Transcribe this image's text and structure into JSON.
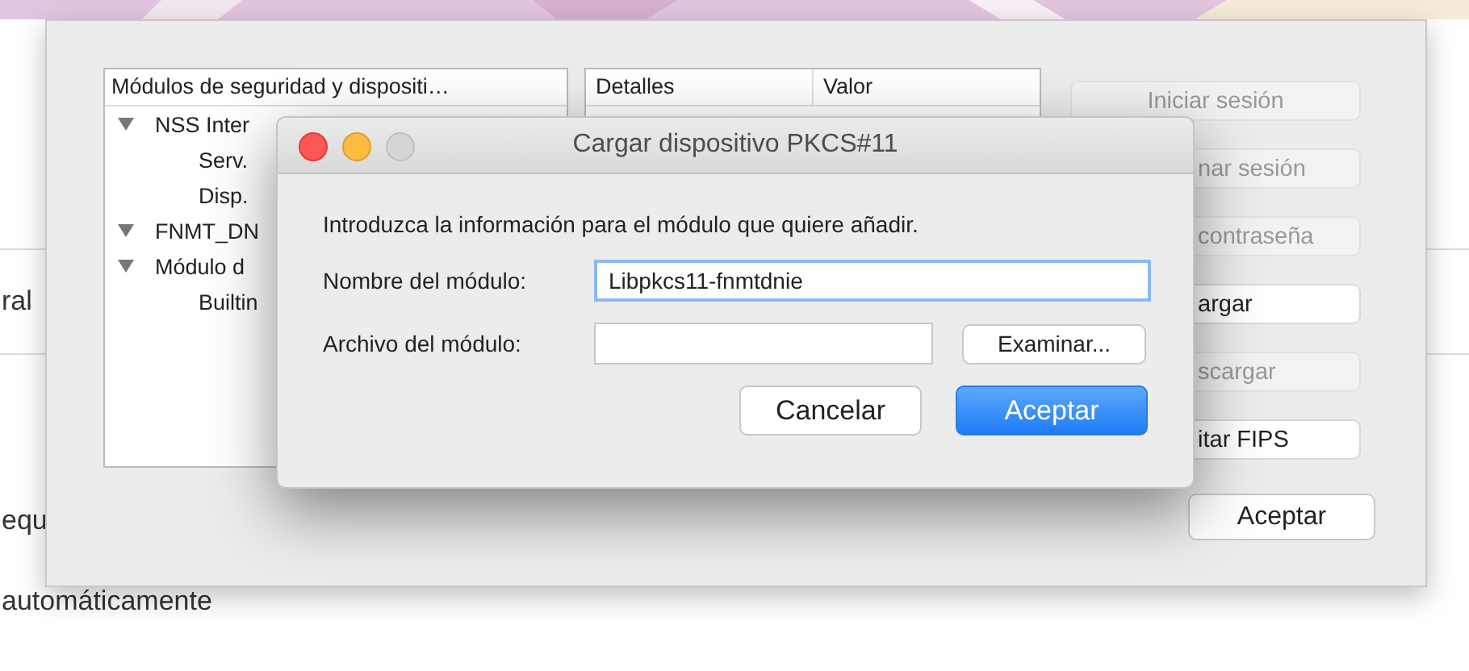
{
  "background_page": {
    "texts": [
      "ral",
      "equ",
      "automáticamente"
    ]
  },
  "security_devices_window": {
    "tree": {
      "column": "Módulos de seguridad y dispositi…",
      "items": [
        {
          "label": "NSS Inter",
          "expanded": true,
          "children": [
            {
              "label": "Serv."
            },
            {
              "label": "Disp."
            }
          ]
        },
        {
          "label": "FNMT_DN",
          "expanded": true
        },
        {
          "label": "Módulo d",
          "expanded": true,
          "children": [
            {
              "label": "Builtin"
            }
          ]
        }
      ]
    },
    "details": {
      "columns": [
        "Detalles",
        "Valor"
      ]
    },
    "buttons": [
      {
        "label": "Iniciar sesión",
        "disabled": true
      },
      {
        "label": "nar sesión",
        "disabled": true
      },
      {
        "label": "contraseña",
        "disabled": true
      },
      {
        "label": "argar",
        "disabled": false
      },
      {
        "label": "scargar",
        "disabled": true
      },
      {
        "label": "itar FIPS",
        "disabled": false
      }
    ],
    "ok_button": "Aceptar"
  },
  "dialog": {
    "title": "Cargar dispositivo PKCS#11",
    "instructions": "Introduzca la información para el módulo que quiere añadir.",
    "fields": [
      {
        "label": "Nombre del módulo:",
        "value": "Libpkcs11-fnmtdnie",
        "focused": true
      },
      {
        "label": "Archivo del módulo:",
        "focused": false
      }
    ],
    "browse_button": "Examinar...",
    "buttons": [
      {
        "label": "Cancelar",
        "default": false
      },
      {
        "label": "Aceptar",
        "default": true
      }
    ]
  }
}
